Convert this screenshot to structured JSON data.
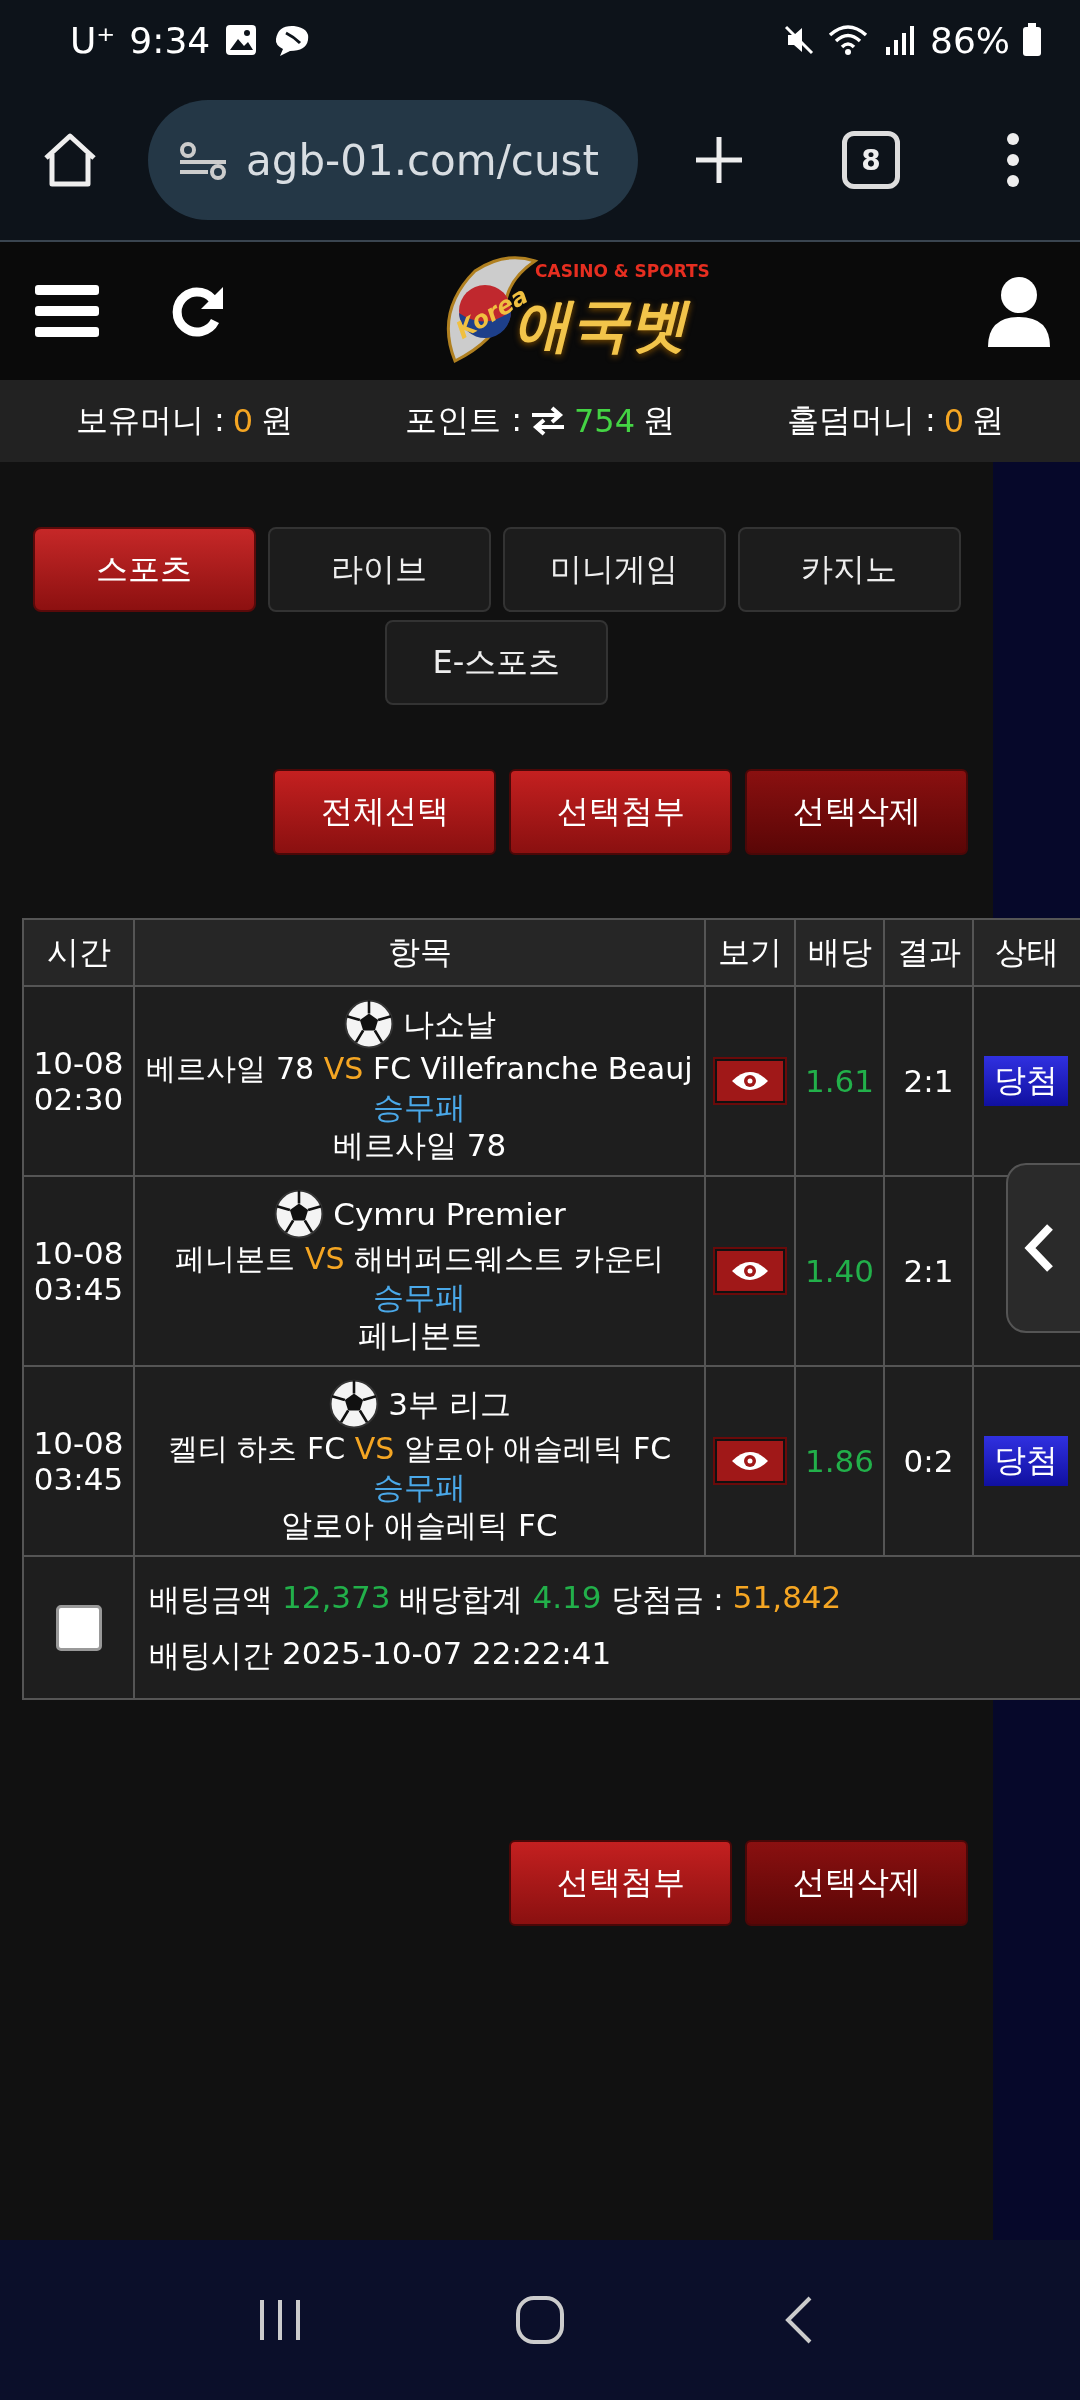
{
  "status_bar": {
    "carrier": "U⁺",
    "time": "9:34",
    "battery": "86%"
  },
  "browser": {
    "url": "agb-01.com/cust",
    "tab_count": "8"
  },
  "logo": {
    "flag_text": "Korea",
    "tagline": "CASINO & SPORTS",
    "name": "애국벳"
  },
  "balances": [
    {
      "kind": "plain",
      "label": "보유머니 :",
      "value": "0",
      "unit": "원"
    },
    {
      "kind": "point",
      "label": "포인트 :",
      "value": "754",
      "unit": "원"
    },
    {
      "kind": "plain",
      "label": "홀덤머니 :",
      "value": "0",
      "unit": "원"
    }
  ],
  "tabs": [
    {
      "label": "스포츠",
      "selected": true
    },
    {
      "label": "라이브",
      "selected": false
    },
    {
      "label": "미니게임",
      "selected": false
    },
    {
      "label": "카지노",
      "selected": false
    },
    {
      "label": "E-스포츠",
      "selected": false
    }
  ],
  "actions": [
    {
      "label": "전체선택",
      "kind": "primary"
    },
    {
      "label": "선택첨부",
      "kind": "primary"
    },
    {
      "label": "선택삭제",
      "kind": "delete"
    }
  ],
  "table": {
    "columns": [
      "시간",
      "항목",
      "보기",
      "배당",
      "결과",
      "상태"
    ],
    "rows": [
      {
        "date": "10-08",
        "time": "02:30",
        "league": "나쇼날",
        "home": "베르사일 78",
        "vs": "VS",
        "away": "FC Villefranche Beauj",
        "market": "승무패",
        "pick": "베르사일 78",
        "odds": "1.61",
        "result": "2:1",
        "status": "당첨"
      },
      {
        "date": "10-08",
        "time": "03:45",
        "league": "Cymru Premier",
        "home": "페니본트",
        "vs": "VS",
        "away": "해버퍼드웨스트 카운티",
        "market": "승무패",
        "pick": "페니본트",
        "odds": "1.40",
        "result": "2:1"
      },
      {
        "date": "10-08",
        "time": "03:45",
        "league": "3부 리그",
        "home": "켈티 하츠 FC",
        "vs": "VS",
        "away": "알로아 애슬레틱 FC",
        "market": "승무패",
        "pick": "알로아 애슬레틱 FC",
        "odds": "1.86",
        "result": "0:2",
        "status": "당첨"
      }
    ],
    "summary": {
      "checked": false,
      "bet_amount_label": "배팅금액",
      "bet_amount": "12,373",
      "odds_total_label": "배당합계",
      "odds_total": "4.19",
      "payout_label": "당첨금 :",
      "payout": "51,842",
      "bet_time_label": "배팅시간",
      "bet_time": "2025-10-07 22:22:41"
    }
  },
  "bottom_actions": [
    {
      "label": "선택첨부",
      "kind": "primary"
    },
    {
      "label": "선택삭제",
      "kind": "delete"
    }
  ]
}
